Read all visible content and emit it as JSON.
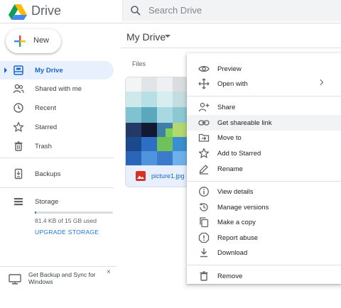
{
  "app": {
    "brand": "Drive",
    "search_placeholder": "Search Drive"
  },
  "sidebar": {
    "new_label": "New",
    "items": [
      {
        "label": "My Drive",
        "icon": "my-drive-icon",
        "active": true
      },
      {
        "label": "Shared with me",
        "icon": "people-icon"
      },
      {
        "label": "Recent",
        "icon": "clock-icon"
      },
      {
        "label": "Starred",
        "icon": "star-icon"
      },
      {
        "label": "Trash",
        "icon": "trash-icon"
      },
      {
        "label": "Backups",
        "icon": "backup-icon"
      },
      {
        "label": "Storage",
        "icon": "storage-icon"
      }
    ],
    "storage": {
      "used_text": "81.4 KB of 15 GB used",
      "upgrade_label": "UPGRADE STORAGE",
      "used_fraction": 0.005
    },
    "promo": {
      "text": "Get Backup and Sync for Windows",
      "close": "×"
    }
  },
  "main": {
    "breadcrumb": "My Drive",
    "section_label": "Files",
    "files": [
      {
        "name": "picture1.jpg",
        "type": "image"
      }
    ]
  },
  "context_menu": {
    "items": [
      {
        "label": "Preview",
        "icon": "eye-icon"
      },
      {
        "label": "Open with",
        "icon": "move-arrows-icon",
        "submenu": true
      },
      {
        "label": "Share",
        "icon": "person-add-icon"
      },
      {
        "label": "Get shareable link",
        "icon": "link-icon",
        "highlighted": true
      },
      {
        "label": "Move to",
        "icon": "folder-move-icon"
      },
      {
        "label": "Add to Starred",
        "icon": "star-icon"
      },
      {
        "label": "Rename",
        "icon": "pencil-icon"
      },
      {
        "label": "View details",
        "icon": "info-icon"
      },
      {
        "label": "Manage versions",
        "icon": "history-icon"
      },
      {
        "label": "Make a copy",
        "icon": "copy-icon"
      },
      {
        "label": "Report abuse",
        "icon": "report-icon"
      },
      {
        "label": "Download",
        "icon": "download-icon"
      },
      {
        "label": "Remove",
        "icon": "trash-icon"
      }
    ]
  },
  "colors": {
    "accent": "#1a73e8",
    "active_bg": "#e8f0fe",
    "hover_bg": "#f1f3f4"
  }
}
